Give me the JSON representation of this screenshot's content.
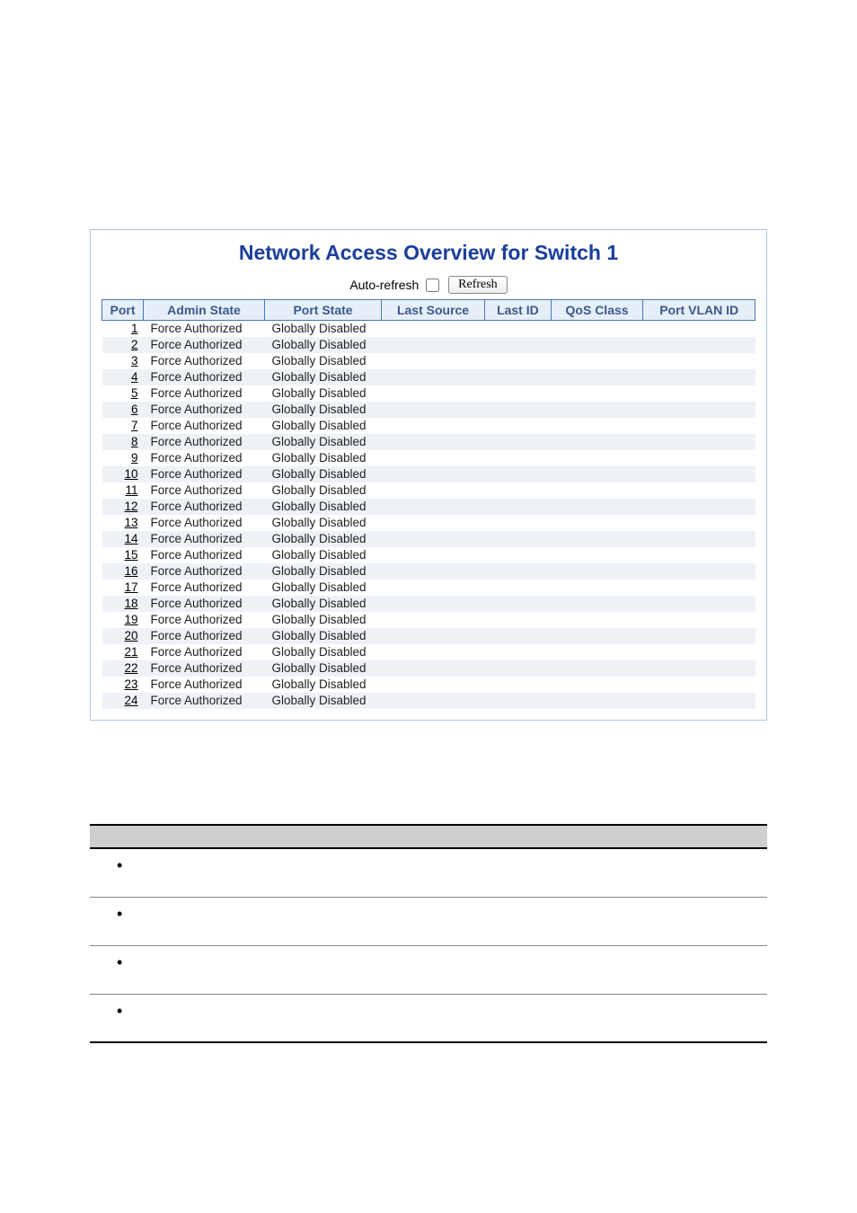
{
  "title": "Network Access Overview for Switch 1",
  "controls": {
    "auto_refresh_label": "Auto-refresh",
    "auto_refresh_checked": false,
    "refresh_label": "Refresh"
  },
  "table": {
    "headers": {
      "port": "Port",
      "admin_state": "Admin State",
      "port_state": "Port State",
      "last_source": "Last Source",
      "last_id": "Last ID",
      "qos_class": "QoS Class",
      "port_vlan_id": "Port VLAN ID"
    },
    "rows": [
      {
        "port": "1",
        "admin_state": "Force Authorized",
        "port_state": "Globally Disabled",
        "last_source": "",
        "last_id": "",
        "qos_class": "",
        "port_vlan_id": ""
      },
      {
        "port": "2",
        "admin_state": "Force Authorized",
        "port_state": "Globally Disabled",
        "last_source": "",
        "last_id": "",
        "qos_class": "",
        "port_vlan_id": ""
      },
      {
        "port": "3",
        "admin_state": "Force Authorized",
        "port_state": "Globally Disabled",
        "last_source": "",
        "last_id": "",
        "qos_class": "",
        "port_vlan_id": ""
      },
      {
        "port": "4",
        "admin_state": "Force Authorized",
        "port_state": "Globally Disabled",
        "last_source": "",
        "last_id": "",
        "qos_class": "",
        "port_vlan_id": ""
      },
      {
        "port": "5",
        "admin_state": "Force Authorized",
        "port_state": "Globally Disabled",
        "last_source": "",
        "last_id": "",
        "qos_class": "",
        "port_vlan_id": ""
      },
      {
        "port": "6",
        "admin_state": "Force Authorized",
        "port_state": "Globally Disabled",
        "last_source": "",
        "last_id": "",
        "qos_class": "",
        "port_vlan_id": ""
      },
      {
        "port": "7",
        "admin_state": "Force Authorized",
        "port_state": "Globally Disabled",
        "last_source": "",
        "last_id": "",
        "qos_class": "",
        "port_vlan_id": ""
      },
      {
        "port": "8",
        "admin_state": "Force Authorized",
        "port_state": "Globally Disabled",
        "last_source": "",
        "last_id": "",
        "qos_class": "",
        "port_vlan_id": ""
      },
      {
        "port": "9",
        "admin_state": "Force Authorized",
        "port_state": "Globally Disabled",
        "last_source": "",
        "last_id": "",
        "qos_class": "",
        "port_vlan_id": ""
      },
      {
        "port": "10",
        "admin_state": "Force Authorized",
        "port_state": "Globally Disabled",
        "last_source": "",
        "last_id": "",
        "qos_class": "",
        "port_vlan_id": ""
      },
      {
        "port": "11",
        "admin_state": "Force Authorized",
        "port_state": "Globally Disabled",
        "last_source": "",
        "last_id": "",
        "qos_class": "",
        "port_vlan_id": ""
      },
      {
        "port": "12",
        "admin_state": "Force Authorized",
        "port_state": "Globally Disabled",
        "last_source": "",
        "last_id": "",
        "qos_class": "",
        "port_vlan_id": ""
      },
      {
        "port": "13",
        "admin_state": "Force Authorized",
        "port_state": "Globally Disabled",
        "last_source": "",
        "last_id": "",
        "qos_class": "",
        "port_vlan_id": ""
      },
      {
        "port": "14",
        "admin_state": "Force Authorized",
        "port_state": "Globally Disabled",
        "last_source": "",
        "last_id": "",
        "qos_class": "",
        "port_vlan_id": ""
      },
      {
        "port": "15",
        "admin_state": "Force Authorized",
        "port_state": "Globally Disabled",
        "last_source": "",
        "last_id": "",
        "qos_class": "",
        "port_vlan_id": ""
      },
      {
        "port": "16",
        "admin_state": "Force Authorized",
        "port_state": "Globally Disabled",
        "last_source": "",
        "last_id": "",
        "qos_class": "",
        "port_vlan_id": ""
      },
      {
        "port": "17",
        "admin_state": "Force Authorized",
        "port_state": "Globally Disabled",
        "last_source": "",
        "last_id": "",
        "qos_class": "",
        "port_vlan_id": ""
      },
      {
        "port": "18",
        "admin_state": "Force Authorized",
        "port_state": "Globally Disabled",
        "last_source": "",
        "last_id": "",
        "qos_class": "",
        "port_vlan_id": ""
      },
      {
        "port": "19",
        "admin_state": "Force Authorized",
        "port_state": "Globally Disabled",
        "last_source": "",
        "last_id": "",
        "qos_class": "",
        "port_vlan_id": ""
      },
      {
        "port": "20",
        "admin_state": "Force Authorized",
        "port_state": "Globally Disabled",
        "last_source": "",
        "last_id": "",
        "qos_class": "",
        "port_vlan_id": ""
      },
      {
        "port": "21",
        "admin_state": "Force Authorized",
        "port_state": "Globally Disabled",
        "last_source": "",
        "last_id": "",
        "qos_class": "",
        "port_vlan_id": ""
      },
      {
        "port": "22",
        "admin_state": "Force Authorized",
        "port_state": "Globally Disabled",
        "last_source": "",
        "last_id": "",
        "qos_class": "",
        "port_vlan_id": ""
      },
      {
        "port": "23",
        "admin_state": "Force Authorized",
        "port_state": "Globally Disabled",
        "last_source": "",
        "last_id": "",
        "qos_class": "",
        "port_vlan_id": ""
      },
      {
        "port": "24",
        "admin_state": "Force Authorized",
        "port_state": "Globally Disabled",
        "last_source": "",
        "last_id": "",
        "qos_class": "",
        "port_vlan_id": ""
      }
    ]
  },
  "lower": {
    "bullet": "•",
    "rows": 4
  }
}
